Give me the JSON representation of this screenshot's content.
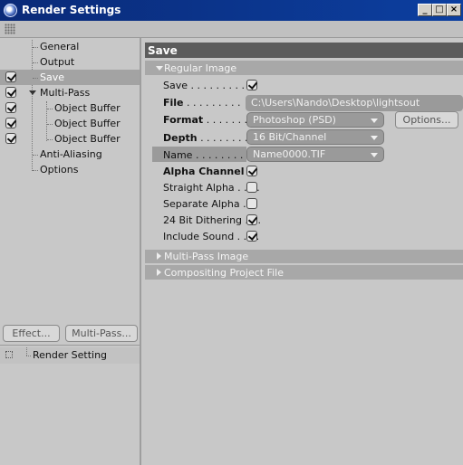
{
  "window": {
    "title": "Render Settings",
    "buttons": {
      "minimize": "_",
      "maximize": "□",
      "close": "×"
    }
  },
  "tree": {
    "items": [
      {
        "label": "General",
        "checked": false
      },
      {
        "label": "Output",
        "checked": false
      },
      {
        "label": "Save",
        "checked": true,
        "selected": true
      },
      {
        "label": "Multi-Pass",
        "checked": true
      },
      {
        "label": "Object Buffer",
        "checked": true
      },
      {
        "label": "Object Buffer",
        "checked": true
      },
      {
        "label": "Object Buffer",
        "checked": true
      },
      {
        "label": "Anti-Aliasing",
        "checked": false
      },
      {
        "label": "Options",
        "checked": false
      }
    ]
  },
  "left_buttons": {
    "effect": "Effect...",
    "multipass": "Multi-Pass..."
  },
  "render_setting_item": "Render Setting",
  "panel": {
    "title": "Save",
    "regular_image": "Regular Image",
    "fields": {
      "save_label": "Save . . . . . . . . . . .",
      "file_label": "File",
      "file_dots": ". . . . . . . . .",
      "file_value": "C:\\Users\\Nando\\Desktop\\lightsout",
      "format_label": "Format",
      "format_dots": ". . . . . . . .",
      "format_value": "Photoshop (PSD)",
      "options_button": "Options...",
      "depth_label": "Depth",
      "depth_dots": ". . . . . . . . .",
      "depth_value": "16 Bit/Channel",
      "name_label": "Name",
      "name_dots": ". . . . . . . . .",
      "name_value": "Name0000.TIF",
      "alpha_channel": "Alpha Channel",
      "straight_alpha": "Straight Alpha . . . .",
      "separate_alpha": "Separate Alpha . .",
      "dithering": "24 Bit Dithering . . .",
      "include_sound": "Include Sound . . . ."
    },
    "checks": {
      "save": true,
      "alpha_channel": true,
      "straight_alpha": false,
      "separate_alpha": false,
      "dithering": true,
      "include_sound": true
    },
    "multi_pass_image": "Multi-Pass Image",
    "compositing_project_file": "Compositing Project File"
  }
}
